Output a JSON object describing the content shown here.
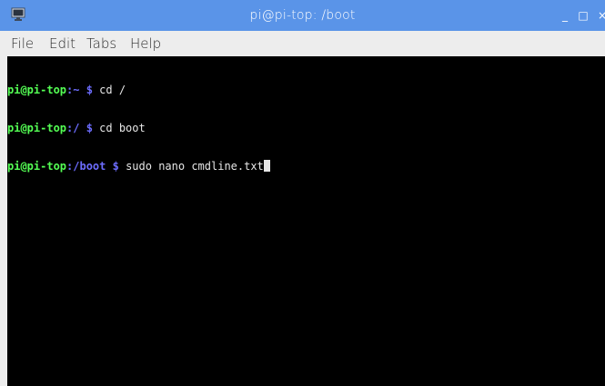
{
  "window": {
    "title": "pi@pi-top: /boot",
    "app_icon": "terminal-monitor-icon",
    "minimize_label": "_",
    "maximize_label": "□",
    "close_label": "×"
  },
  "menu": {
    "items": [
      {
        "label": "File"
      },
      {
        "label": "Edit"
      },
      {
        "label": "Tabs"
      },
      {
        "label": "Help"
      }
    ]
  },
  "terminal": {
    "lines": [
      {
        "user": "pi@pi-top",
        "path": ":~",
        "dollar": " $",
        "command": " cd /"
      },
      {
        "user": "pi@pi-top",
        "path": ":/",
        "dollar": " $",
        "command": " cd boot"
      },
      {
        "user": "pi@pi-top",
        "path": ":/boot",
        "dollar": " $",
        "command": " sudo nano cmdline.txt"
      }
    ]
  },
  "colors": {
    "titlebar": "#5a94e8",
    "terminal_bg": "#000000",
    "prompt_user": "#54ff54",
    "prompt_path": "#6d6dff",
    "text": "#e6e6e6"
  }
}
